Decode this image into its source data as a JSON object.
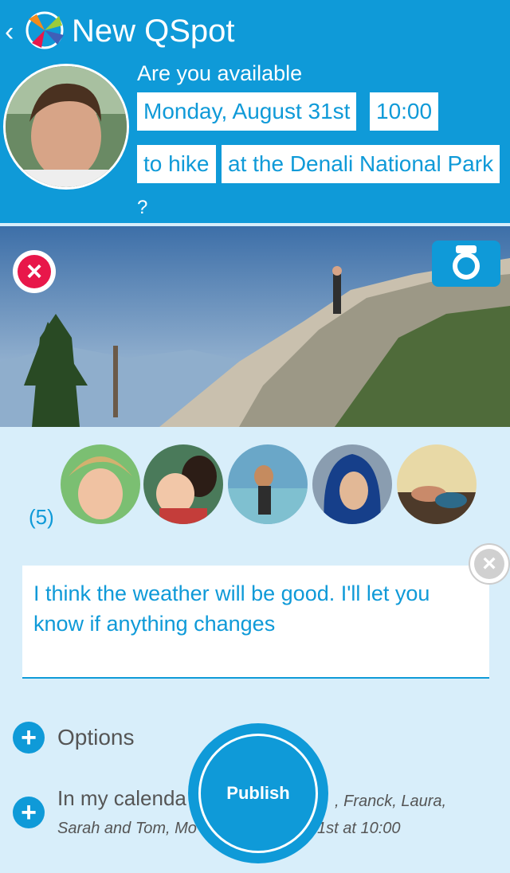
{
  "header": {
    "back_icon": "back-chevron-icon",
    "logo_icon": "qspot-logo-icon",
    "title": "New QSpot",
    "avatar": "user-avatar",
    "question": "Are you available",
    "date": "Monday, August 31st",
    "time": "10:00",
    "activity": "to hike",
    "location": "at the Denali National Park",
    "question_mark": "?"
  },
  "photo": {
    "remove_icon": "remove-photo-icon",
    "camera_icon": "camera-icon",
    "colors": {
      "sky": "#6f9ccc",
      "mountains": "#8faecc",
      "trees": "#294a24"
    }
  },
  "friends": {
    "count": "(5)",
    "avatars": [
      "friend-avatar-1",
      "friend-avatar-2",
      "friend-avatar-3",
      "friend-avatar-4",
      "friend-avatar-5"
    ]
  },
  "comment": {
    "text": "I think the weather will be good. I'll let you know if anything changes",
    "clear_icon": "clear-comment-icon"
  },
  "options": {
    "label": "Options",
    "icon": "plus-icon"
  },
  "calendar": {
    "label": "In my calenda",
    "detail_line1": ", Franck, Laura,",
    "detail_line2": "Sarah and Tom, Mo",
    "detail_line2b": "1st at 10:00",
    "icon": "plus-icon"
  },
  "publish": {
    "label": "Publish"
  },
  "colors": {
    "accent": "#0f9ad8",
    "background": "#d8eefa",
    "danger": "#e8174a"
  }
}
